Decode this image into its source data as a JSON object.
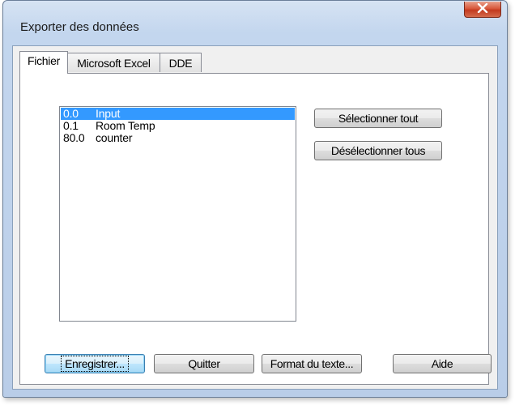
{
  "window": {
    "title": "Exporter des données",
    "close_glyph": "✕"
  },
  "tabs": [
    {
      "label": "Fichier",
      "active": true
    },
    {
      "label": "Microsoft Excel",
      "active": false
    },
    {
      "label": "DDE",
      "active": false
    }
  ],
  "list": {
    "items": [
      {
        "num": "0.0",
        "name": "Input",
        "selected": true
      },
      {
        "num": "0.1",
        "name": "Room Temp",
        "selected": false
      },
      {
        "num": "80.0",
        "name": "counter",
        "selected": false
      }
    ]
  },
  "side_buttons": {
    "select_all": "Sélectionner tout",
    "deselect_all": "Désélectionner tous"
  },
  "bottom_buttons": {
    "save": "Enregistrer...",
    "quit": "Quitter",
    "text_format": "Format du texte...",
    "help": "Aide"
  },
  "colors": {
    "selection": "#3399ff",
    "close_button": "#c33a1f",
    "frame": "#c3d6ee"
  }
}
